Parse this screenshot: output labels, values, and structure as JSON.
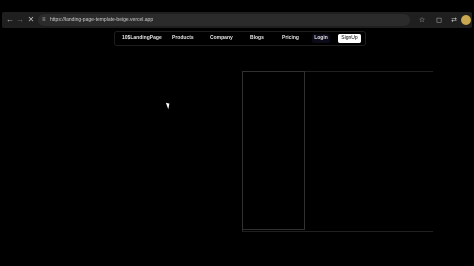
{
  "browser": {
    "url": "https://landing-page-template-beige.vercel.app",
    "back_icon": "arrow-left",
    "forward_icon": "arrow-right",
    "reload_icon": "close-x",
    "site_icon": "tune-icon"
  },
  "nav": {
    "brand": "10$LandingPage",
    "items": [
      "Products",
      "Company",
      "Blogs",
      "Pricing"
    ],
    "login": "Login",
    "signup": "SignUp"
  },
  "colors": {
    "background": "#000000",
    "signup_bg": "#ffffff",
    "avatar": "#c9a84f"
  }
}
